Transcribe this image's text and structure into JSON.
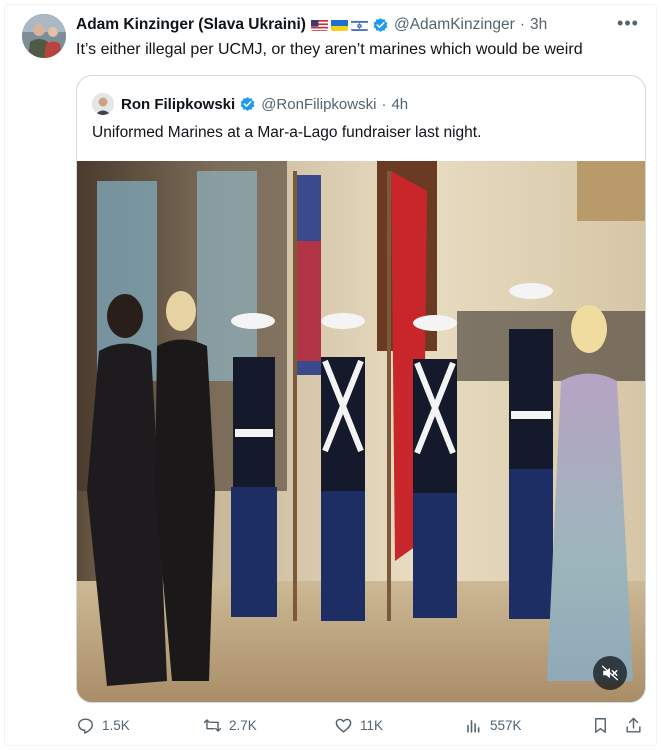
{
  "tweet": {
    "author_name": "Adam Kinzinger (Slava Ukraini)",
    "author_handle": "@AdamKinzinger",
    "separator": "·",
    "time": "3h",
    "text": "It’s either illegal per UCMJ, or they aren’t marines which would be weird",
    "flags": [
      "us-flag-icon",
      "ukraine-flag-icon",
      "israel-flag-icon"
    ],
    "verified_icon": "verified-badge-icon"
  },
  "quoted_tweet": {
    "author_name": "Ron Filipkowski",
    "author_handle": "@RonFilipkowski",
    "separator": "·",
    "time": "4h",
    "text": "Uniformed Marines at a Mar-a-Lago fundraiser last night.",
    "media": {
      "type": "video",
      "mute_icon": "muted-speaker-icon"
    }
  },
  "actions": {
    "replies": "1.5K",
    "reposts": "2.7K",
    "likes": "11K",
    "views": "557K"
  },
  "colors": {
    "text_primary": "#0f1419",
    "text_secondary": "#536471",
    "verified_blue": "#1d9bf0",
    "border": "#cfd9de"
  }
}
